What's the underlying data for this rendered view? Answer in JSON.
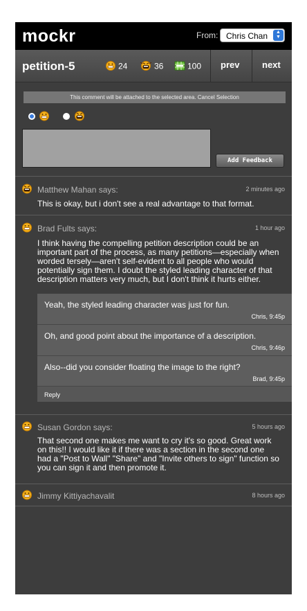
{
  "app": {
    "logo": "mockr"
  },
  "from": {
    "label": "From:",
    "selected_user": "Chris Chan"
  },
  "petition": {
    "title": "petition-5",
    "stats": [
      {
        "icon": "happy-face-icon",
        "value": "24"
      },
      {
        "icon": "angry-face-icon",
        "value": "36"
      },
      {
        "icon": "grid-icon",
        "value": "100"
      }
    ],
    "prev": "prev",
    "next": "next"
  },
  "feedback": {
    "notice": "This comment will be attached to the selected area. Cancel Selection",
    "add_button": "Add Feedback",
    "options": [
      {
        "icon": "happy-face-icon",
        "selected": true
      },
      {
        "icon": "angry-face-icon",
        "selected": false
      }
    ]
  },
  "comments": [
    {
      "author": "Matthew Mahan says:",
      "time": "2 minutes ago",
      "icon": "angry-face-icon",
      "lines": [
        "This is okay, but i don't see a real advantage to that format."
      ]
    },
    {
      "author": "Brad Fults says:",
      "time": "1 hour ago",
      "icon": "happy-face-icon",
      "lines": [
        "I think having the compelling petition description could be an",
        "important part of the process, as many petitions—especially when",
        "worded tersely—aren't self-evident to all people who would",
        "potentially sign them. I doubt the styled leading character of that",
        "description matters very much, but I don't think it hurts either."
      ],
      "replies": [
        {
          "text": "Yeah, the styled leading character was just for fun.",
          "meta": "Chris, 9:45p"
        },
        {
          "text": "Oh, and good point about the importance of a description.",
          "meta": "Chris, 9:46p"
        },
        {
          "text": "Also--did you consider floating the image to the right?",
          "meta": "Brad, 9:45p"
        }
      ],
      "reply_link": "Reply"
    },
    {
      "author": "Susan Gordon says:",
      "time": "5 hours ago",
      "icon": "happy-face-icon",
      "lines": [
        "That second one makes me want to cry it's so good.  Great work",
        "on this!!  I would like it if there was a section in the second one",
        "had a \"Post to Wall\" \"Share\" and \"Invite others to sign\" function so",
        "you can sign it and then promote it."
      ]
    },
    {
      "author": "Jimmy Kittiyachavalit",
      "time": "8 hours ago",
      "icon": "happy-face-icon",
      "lines": []
    }
  ],
  "colors": {
    "background": "#3d3d3d",
    "topbar": "#000000",
    "accent": "#3a7de0"
  }
}
